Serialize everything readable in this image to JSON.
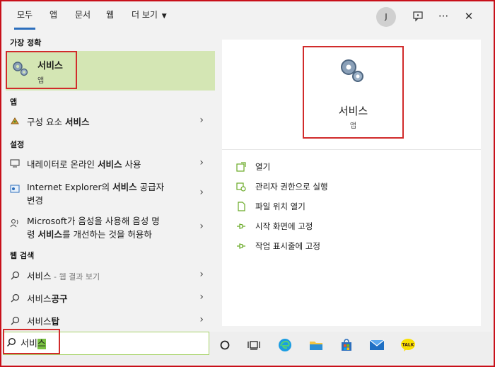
{
  "tabs": [
    {
      "label": "모두",
      "active": true
    },
    {
      "label": "앱",
      "active": false
    },
    {
      "label": "문서",
      "active": false
    },
    {
      "label": "웹",
      "active": false
    },
    {
      "label": "더 보기",
      "active": false
    }
  ],
  "header": {
    "avatar_initial": "J",
    "more_label": "···",
    "close_label": "✕"
  },
  "left": {
    "best_match_heading": "가장 정확",
    "best_match": {
      "title": "서비스",
      "subtitle": "앱"
    },
    "apps_heading": "앱",
    "apps": [
      {
        "prefix": "구성 요소 ",
        "bold": "서비스"
      }
    ],
    "settings_heading": "설정",
    "settings": [
      {
        "line1_prefix": "내레이터로 온라인 ",
        "line1_bold": "서비스",
        "line1_suffix": " 사용"
      },
      {
        "line1_prefix": "Internet Explorer의 ",
        "line1_bold": "서비스",
        "line1_suffix": " 공급자",
        "line2": "변경"
      },
      {
        "line1_prefix": "Microsoft가 음성을 사용해 음성 명",
        "line2_prefix": "령 ",
        "line2_bold": "서비스",
        "line2_suffix": "를 개선하는 것을 허용하"
      }
    ],
    "web_heading": "웹 검색",
    "web": [
      {
        "text": "서비스",
        "suffix": " - 웹 결과 보기"
      },
      {
        "text": "서비스",
        "bold": "공구"
      },
      {
        "text": "서비스",
        "bold": "탑"
      }
    ]
  },
  "preview": {
    "title": "서비스",
    "subtitle": "앱"
  },
  "actions": [
    {
      "label": "열기",
      "icon": "open-icon"
    },
    {
      "label": "관리자 권한으로 실행",
      "icon": "shield-icon"
    },
    {
      "label": "파일 위치 열기",
      "icon": "file-icon"
    },
    {
      "label": "시작 화면에 고정",
      "icon": "pin-icon"
    },
    {
      "label": "작업 표시줄에 고정",
      "icon": "pin-icon"
    }
  ],
  "search": {
    "typed": "서비",
    "selected": "스"
  },
  "colors": {
    "accent": "#2d6fbd",
    "highlight": "#d4e6b4",
    "annotation": "#d12b2b",
    "selection": "#7ac142"
  }
}
